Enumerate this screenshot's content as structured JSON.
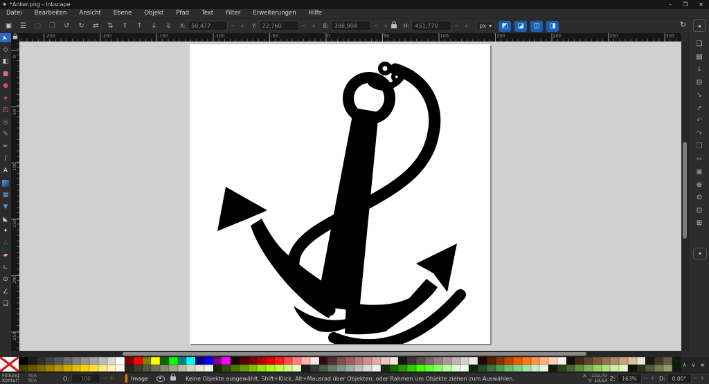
{
  "window": {
    "title": "*Anker.png - Inkscape",
    "app_icon": "inkscape-logo",
    "controls": {
      "minimize": "–",
      "maximize": "❐",
      "close": "✕"
    }
  },
  "menubar": {
    "items": [
      "Datei",
      "Bearbeiten",
      "Ansicht",
      "Ebene",
      "Objekt",
      "Pfad",
      "Text",
      "Filter",
      "Erweiterungen",
      "Hilfe"
    ]
  },
  "toolbar": {
    "buttons": [
      {
        "name": "select-all",
        "glyph": "▣",
        "color": "#c8c8c8"
      },
      {
        "name": "select-all-layers",
        "glyph": "☰",
        "color": "#c8c8c8"
      },
      {
        "name": "deselect",
        "glyph": "▢",
        "color": "#5f5f5f"
      },
      {
        "name": "selection-box",
        "glyph": "❐",
        "color": "#5f5f5f"
      },
      {
        "name": "rotate-ccw",
        "glyph": "↺",
        "color": "#8fb573"
      },
      {
        "name": "rotate-cw",
        "glyph": "↻",
        "color": "#8fb573"
      },
      {
        "name": "flip-horizontal",
        "glyph": "⇄",
        "color": "#b0b0b0"
      },
      {
        "name": "flip-vertical",
        "glyph": "⇅",
        "color": "#b0b0b0"
      },
      {
        "name": "raise-to-top",
        "glyph": "⇑",
        "color": "#8fb573"
      },
      {
        "name": "raise",
        "glyph": "↑",
        "color": "#8fb573"
      },
      {
        "name": "lower",
        "glyph": "↓",
        "color": "#8fb573"
      },
      {
        "name": "lower-to-bottom",
        "glyph": "⇓",
        "color": "#8fb573"
      }
    ],
    "fields": [
      {
        "name": "x",
        "label": "X:",
        "value": "50,477"
      },
      {
        "name": "y",
        "label": "Y:",
        "value": "22,760"
      },
      {
        "name": "b",
        "label": "B:",
        "value": "398,904"
      },
      {
        "name": "h",
        "label": "H:",
        "value": "451,770"
      }
    ],
    "spinner_minus": "−",
    "spinner_plus": "+",
    "unit": {
      "value": "px",
      "arrow": "▾"
    },
    "toggles": [
      {
        "name": "scale-stroke-toggle",
        "glyph": "◩"
      },
      {
        "name": "scale-corners-toggle",
        "glyph": "◪"
      },
      {
        "name": "scale-gradient-toggle",
        "glyph": "◫"
      },
      {
        "name": "scale-pattern-toggle",
        "glyph": "◨"
      }
    ],
    "snap_glyph": "↻",
    "collapse_glyph": "◂"
  },
  "toolbox": {
    "tools": [
      {
        "name": "selector",
        "glyph": "➤",
        "color": "#ececec",
        "rot": -105,
        "active": true
      },
      {
        "name": "node-editor",
        "glyph": "◇",
        "color": "#cfcfcf"
      },
      {
        "name": "shape-builder",
        "glyph": "◧",
        "color": "#cfcfcf"
      },
      {
        "name": "rectangle",
        "glyph": "■",
        "color": "#de5fa4"
      },
      {
        "name": "ellipse",
        "glyph": "●",
        "color": "#d8427f"
      },
      {
        "name": "star",
        "glyph": "★",
        "color": "#d8427f"
      },
      {
        "name": "box-3d",
        "glyph": "◰",
        "color": "#cf7ab0"
      },
      {
        "name": "spiral",
        "glyph": "◎",
        "color": "#cf7ab0"
      },
      {
        "name": "pencil",
        "glyph": "✎",
        "color": "#7cb94e"
      },
      {
        "name": "bezier-pen",
        "glyph": "✒",
        "color": "#7cb94e"
      },
      {
        "name": "calligraphy",
        "glyph": "∕",
        "color": "#cfcfcf"
      },
      {
        "name": "text",
        "glyph": "A",
        "color": "#ededed"
      },
      {
        "name": "gradient",
        "glyph": "",
        "color": "#62a0ea",
        "css": "grad"
      },
      {
        "name": "mesh-gradient",
        "glyph": "▦",
        "color": "#6fa3d8"
      },
      {
        "name": "dropper",
        "glyph": "▼",
        "color": "#4a90d9"
      },
      {
        "name": "paint-bucket",
        "glyph": "◣",
        "color": "#cfcfcf"
      },
      {
        "name": "tweak",
        "glyph": "✦",
        "color": "#cfcfcf"
      },
      {
        "name": "spray",
        "glyph": "∴",
        "color": "#cfcfcf"
      },
      {
        "name": "eraser",
        "glyph": "▰",
        "color": "#e08ab0"
      },
      {
        "name": "connector",
        "glyph": "∟",
        "color": "#cfcfcf"
      },
      {
        "name": "zoom",
        "glyph": "⊙",
        "color": "#cfcfcf"
      },
      {
        "name": "measure",
        "glyph": "∠",
        "color": "#cfcfcf"
      },
      {
        "name": "pages",
        "glyph": "❏",
        "color": "#cfcfcf"
      }
    ]
  },
  "rulers": {
    "horizontal_labels": [
      "-250",
      "-200",
      "-150",
      "-100",
      "-50",
      "0",
      "50",
      "100",
      "150",
      "200",
      "250",
      "300"
    ],
    "vertical_labels": [
      "0",
      "50",
      "100",
      "150",
      "200",
      "250"
    ]
  },
  "sidebar": {
    "items": [
      {
        "name": "new-document",
        "glyph": "❏",
        "color": "#c8c8c8"
      },
      {
        "name": "open-document",
        "glyph": "▤",
        "color": "#c8c8c8"
      },
      {
        "name": "save-document",
        "glyph": "↓",
        "color": "#79b64a"
      },
      {
        "name": "print-document",
        "glyph": "⊟",
        "color": "#c8c8c8"
      },
      {
        "name": "import-image",
        "glyph": "↘",
        "color": "#79b64a"
      },
      {
        "name": "export-image",
        "glyph": "↗",
        "color": "#79b64a"
      },
      {
        "name": "undo",
        "glyph": "↶",
        "color": "#8a8a8a"
      },
      {
        "name": "redo",
        "glyph": "↷",
        "color": "#8a8a8a"
      },
      {
        "name": "duplicate",
        "glyph": "❐",
        "color": "#8a8a8a"
      },
      {
        "name": "cut",
        "glyph": "✂",
        "color": "#8a8a8a"
      },
      {
        "name": "paste",
        "glyph": "▣",
        "color": "#8a8a8a"
      },
      {
        "name": "zoom-to-selection",
        "glyph": "⊕",
        "color": "#c8c8c8"
      },
      {
        "name": "zoom-to-drawing",
        "glyph": "⊙",
        "color": "#c8c8c8"
      },
      {
        "name": "zoom-to-page",
        "glyph": "⊡",
        "color": "#c8c8c8"
      },
      {
        "name": "zoom-page-width",
        "glyph": "⊞",
        "color": "#c8c8c8"
      }
    ],
    "more_glyph": "▾"
  },
  "palette": {
    "row1": [
      "#000000",
      "#1a1a1a",
      "#2e2e2e",
      "#424242",
      "#565656",
      "#6a6a6a",
      "#7e7e7e",
      "#929292",
      "#a6a6a6",
      "#bababa",
      "#d9d9d9",
      "#ffffff",
      "#800000",
      "#ff0000",
      "#808000",
      "#ffff00",
      "#006600",
      "#00ff00",
      "#008080",
      "#00ffff",
      "#000080",
      "#0000ff",
      "#800080",
      "#ff00ff",
      "#1a0000",
      "#4d0000",
      "#800000",
      "#b30000",
      "#e60000",
      "#ff1a1a",
      "#ff4d4d",
      "#ff8080",
      "#ffb3b3",
      "#ffe6e6",
      "#2b0f0f",
      "#553030",
      "#804d4d",
      "#a06060",
      "#bf7878",
      "#d49090",
      "#e3aaaa",
      "#efc6c6",
      "#f9e3e3",
      "#1a1414",
      "#3d3333",
      "#5c4d4d",
      "#7a6666",
      "#968080",
      "#ad9898",
      "#c3b3b3",
      "#dbcfcf",
      "#f0eaea",
      "#1f0a00",
      "#521f00",
      "#853300",
      "#b84700",
      "#eb5c00",
      "#ff7519",
      "#ff944d",
      "#ffb380",
      "#ffd2b3",
      "#fff0e6",
      "#140d08",
      "#3d2b1a",
      "#5c422b",
      "#7a593d",
      "#967050",
      "#ad8866",
      "#c3a380",
      "#dbc1a3",
      "#f0e4d4",
      "#1a1a14",
      "#403a30",
      "#66594d",
      "#0d1f00"
    ],
    "row2": [
      "#4d4000",
      "#665500",
      "#806a00",
      "#998000",
      "#b39500",
      "#ccaa00",
      "#e6bf00",
      "#ffd500",
      "#ffdf40",
      "#ffe980",
      "#fff3bf",
      "#fffae6",
      "#26261a",
      "#3f3f2e",
      "#585842",
      "#717156",
      "#8a8a6e",
      "#a3a38a",
      "#bcbca6",
      "#d5d5c2",
      "#e6e6da",
      "#f2f2ea",
      "#1a2600",
      "#334d00",
      "#4d7300",
      "#669900",
      "#80bf00",
      "#99e600",
      "#aaff1a",
      "#bfff4d",
      "#d5ff80",
      "#eaffbf",
      "#141a14",
      "#303d30",
      "#4d5c4d",
      "#697a69",
      "#859685",
      "#a1ada1",
      "#bdc4bd",
      "#d9dcd9",
      "#f0f1f0",
      "#0d3300",
      "#1a6600",
      "#269900",
      "#33cc00",
      "#40ff00",
      "#66ff33",
      "#8cff66",
      "#b3ff99",
      "#d9ffcc",
      "#f0ffe6",
      "#0f260f",
      "#264d26",
      "#3d733d",
      "#549954",
      "#6bbf6b",
      "#85d285",
      "#a3e3a3",
      "#c6efc6",
      "#e3f9e3",
      "#141a0d",
      "#2e401f",
      "#486630",
      "#628c42",
      "#7cb254",
      "#96d266",
      "#b0e080",
      "#caeca3",
      "#e4f6c9",
      "#101408",
      "#2b331f",
      "#4d5c38",
      "#6f8052",
      "#8ba06b",
      "#0d1a0d"
    ],
    "controls": [
      {
        "name": "palette-scroll-up",
        "glyph": "∧"
      },
      {
        "name": "palette-scroll-down",
        "glyph": "∨"
      },
      {
        "name": "palette-menu",
        "glyph": "≡"
      }
    ]
  },
  "statusbar": {
    "fill_label": "Füllung:",
    "fill_value": "N/A",
    "stroke_label": "Kontur:",
    "stroke_value": "N/A",
    "opacity_label": "O:",
    "opacity_value": "100",
    "spinner_minus": "−",
    "spinner_plus": "+",
    "layer_name": "Image",
    "message": "Keine Objekte ausgewählt. Shift+Klick, Alt+Mausrad über Objekten, oder Rahmen um Objekte ziehen zum Auswählen.",
    "x_label": "X:",
    "x_value": "-122,70",
    "y_label": "Y:",
    "y_value": "19,63",
    "zoom_label": "Z:",
    "zoom_value": "163%",
    "rotation_label": "D:",
    "rotation_value": "0,00°"
  },
  "canvas": {
    "page_color": "#ffffff",
    "artwork": "anchor-with-rope",
    "artwork_color": "#000000"
  }
}
